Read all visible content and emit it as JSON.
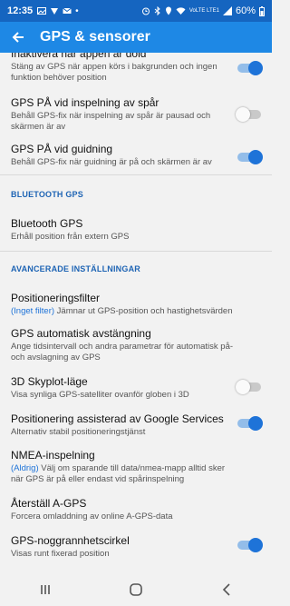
{
  "status_bar": {
    "time": "12:35",
    "icons": [
      "image-icon",
      "gps-icon",
      "mail-icon",
      "dot-icon"
    ],
    "right_icons": [
      "alarm-icon",
      "bluetooth-icon",
      "location-icon",
      "wifi-icon",
      "signal-icon"
    ],
    "network": "VoLTE LTE1",
    "battery": "60%"
  },
  "app_bar": {
    "title": "GPS & sensorer",
    "back_icon": "arrow-left-icon"
  },
  "settings": {
    "hide_app": {
      "title": "Inaktivera när appen är dold",
      "subtitle": "Stäng av GPS när appen körs i bakgrunden och ingen funktion behöver position",
      "enabled": true
    },
    "gps_track": {
      "title": "GPS PÅ vid inspelning av spår",
      "subtitle": "Behåll GPS-fix när inspelning av spår är pausad och skärmen är av",
      "enabled": false
    },
    "gps_guide": {
      "title": "GPS PÅ vid guidning",
      "subtitle": "Behåll GPS-fix när guidning är på och skärmen är av",
      "enabled": true
    },
    "bluetooth_header": "BLUETOOTH GPS",
    "bluetooth_gps": {
      "title": "Bluetooth GPS",
      "subtitle": "Erhåll position från extern GPS"
    },
    "advanced_header": "AVANCERADE INSTÄLLNINGAR",
    "pos_filter": {
      "title": "Positioneringsfilter",
      "value": "(Inget filter)",
      "subtitle": " Jämnar ut GPS-position och hastighetsvärden"
    },
    "auto_off": {
      "title": "GPS automatisk avstängning",
      "subtitle": "Ange tidsintervall och andra parametrar för automatisk på- och avslagning av GPS"
    },
    "skyplot": {
      "title": "3D Skyplot-läge",
      "subtitle": "Visa synliga GPS-satelliter ovanför globen i 3D",
      "enabled": false
    },
    "google_services": {
      "title": "Positionering assisterad av Google Services",
      "subtitle": "Alternativ stabil positioneringstjänst",
      "enabled": true
    },
    "nmea": {
      "title": "NMEA-inspelning",
      "value": "(Aldrig)",
      "subtitle": " Välj om sparande till data/nmea-mapp alltid sker när GPS är på eller endast vid spårinspelning"
    },
    "agps": {
      "title": "Återställ A-GPS",
      "subtitle": "Forcera omladdning av online A-GPS-data"
    },
    "accuracy_circle": {
      "title": "GPS-noggrannhetscirkel",
      "subtitle": "Visas runt fixerad position",
      "enabled": true
    }
  },
  "nav_bar": {
    "recents": "recents-icon",
    "home": "home-icon",
    "back": "back-icon"
  },
  "colors": {
    "status_bar": "#1565c0",
    "app_bar": "#1e88e5",
    "accent": "#1e73d8",
    "section": "#1e64b4"
  }
}
